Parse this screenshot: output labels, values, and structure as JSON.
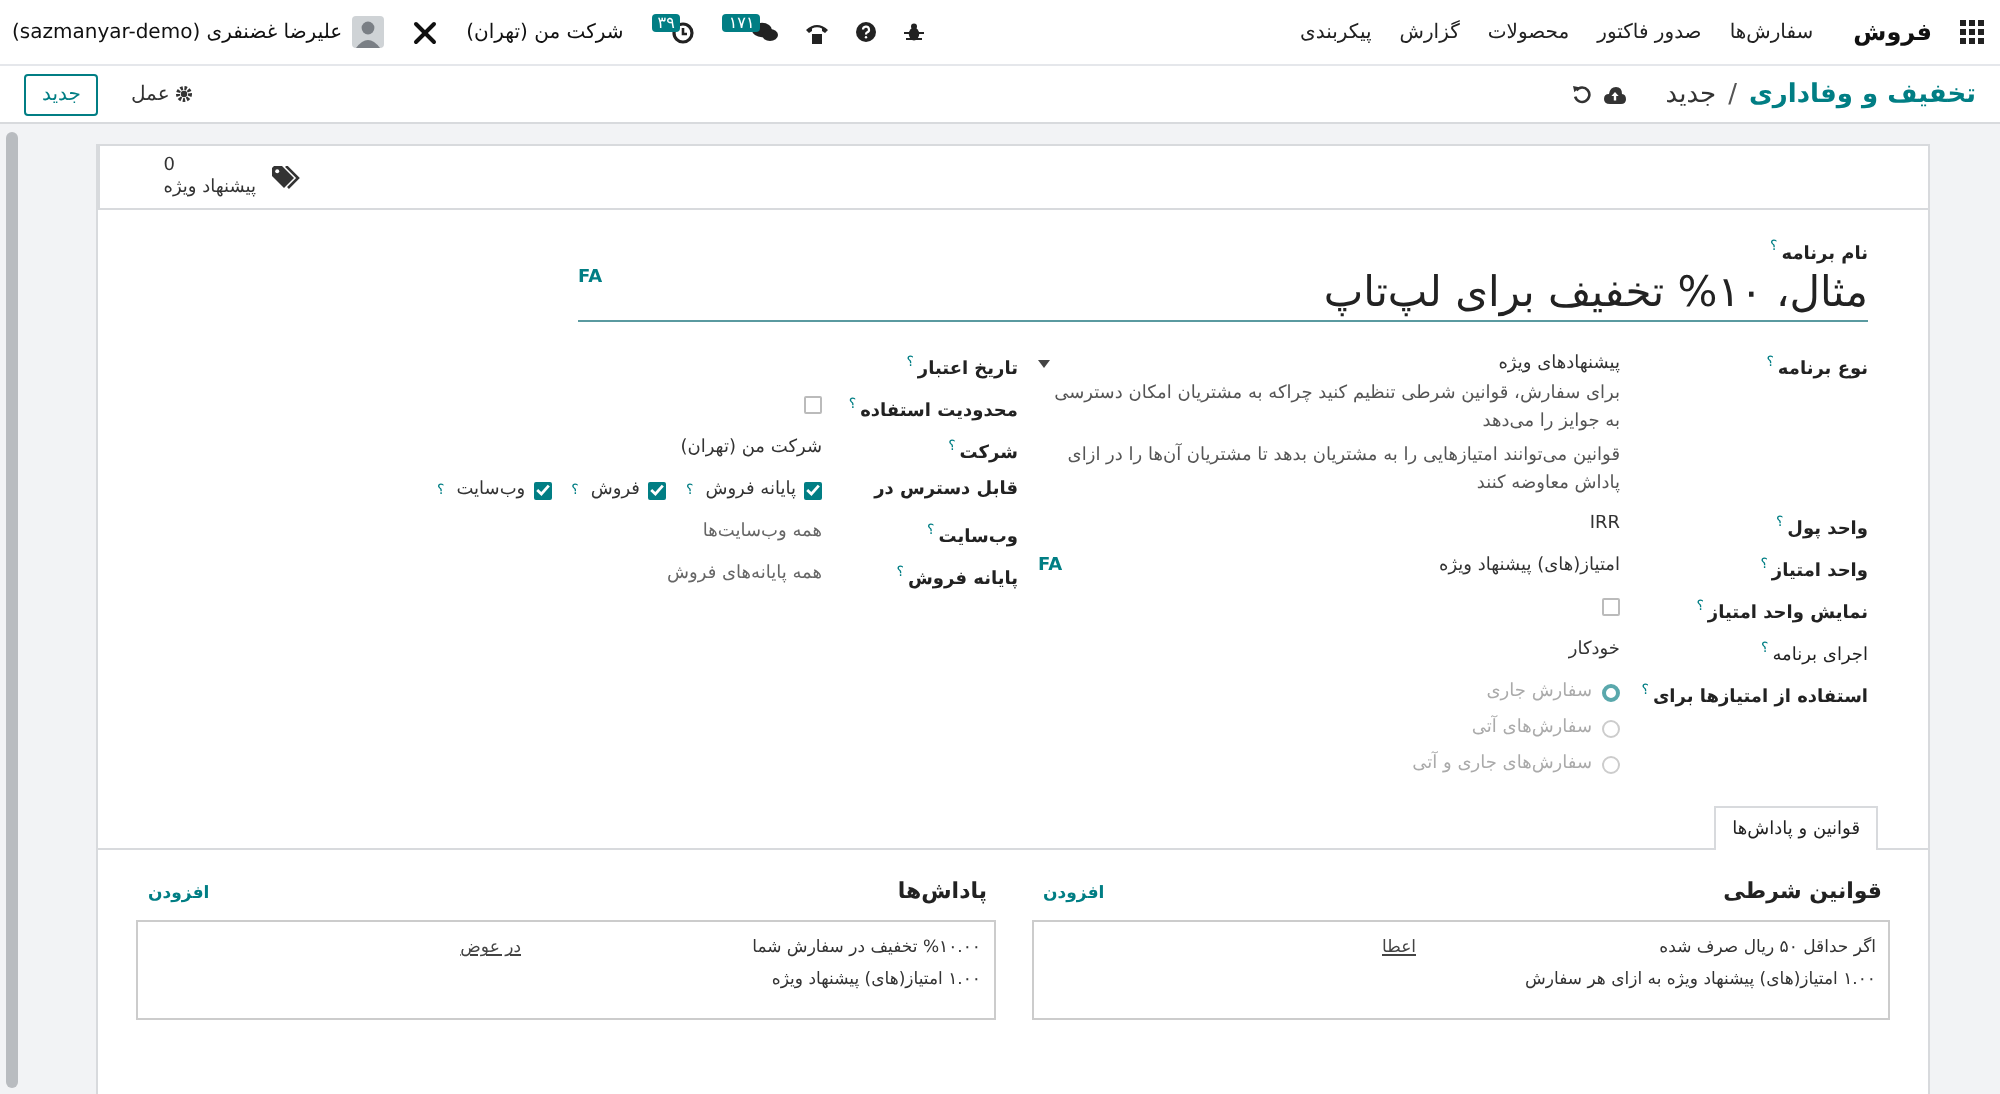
{
  "navbar": {
    "app_name": "فروش",
    "menu": [
      "سفارش‌ها",
      "صدور فاکتور",
      "محصولات",
      "گزارش",
      "پیکربندی"
    ],
    "message_count": "۱۷۱",
    "activity_count": "۳۹",
    "company": "شرکت من (تهران)",
    "user": "علیرضا غضنفری (sazmanyar-demo)"
  },
  "breadcrumb": {
    "parent": "تخفیف و وفاداری",
    "separator": "/",
    "current": "جدید"
  },
  "toolbar": {
    "action_menu": "عمل",
    "new_button": "جدید"
  },
  "stat_button": {
    "value": "0",
    "label": "پیشنهاد ویژه"
  },
  "form": {
    "name_label": "نام برنامه",
    "name_help": "؟",
    "name": "مثال، ۱۰% تخفیف برای لپ‌تاپ",
    "name_lang": "FA",
    "right_fields": [
      {
        "kind": "select",
        "label": "نوع برنامه",
        "help": "؟",
        "bold": true,
        "value": "پیشنهادهای ویژه",
        "description": [
          "برای سفارش، قوانین شرطی تنظیم کنید چراکه به مشتریان امکان دسترسی به جوایز را می‌دهد",
          "قوانین می‌توانند امتیازهایی را به مشتریان بدهد تا مشتریان آن‌ها را در ازای پاداش معاوضه کنند"
        ]
      },
      {
        "kind": "text",
        "label": "واحد پول",
        "help": "؟",
        "bold": true,
        "value": "IRR"
      },
      {
        "kind": "text",
        "label": "واحد امتیاز",
        "help": "؟",
        "bold": true,
        "value": "امتیاز(های) پیشنهاد ویژه",
        "lang": "FA"
      },
      {
        "kind": "checkbox",
        "label": "نمایش واحد امتیاز",
        "help": "؟",
        "bold": true,
        "checked": false
      },
      {
        "kind": "text",
        "label": "اجرای برنامه",
        "help": "؟",
        "bold": false,
        "value": "خودکار"
      },
      {
        "kind": "radio",
        "label": "استفاده از امتیازها برای",
        "help": "؟",
        "bold": true,
        "disabled": true,
        "options": [
          {
            "label": "سفارش جاری",
            "selected": true
          },
          {
            "label": "سفارش‌های آتی",
            "selected": false
          },
          {
            "label": "سفارش‌های جاری و آتی",
            "selected": false
          }
        ]
      }
    ],
    "left_fields": [
      {
        "kind": "empty",
        "label": "تاریخ اعتبار",
        "help": "؟",
        "bold": true
      },
      {
        "kind": "checkbox",
        "label": "محدودیت استفاده",
        "help": "؟",
        "bold": true,
        "checked": false
      },
      {
        "kind": "text",
        "label": "شرکت",
        "help": "؟",
        "bold": true,
        "value": "شرکت من (تهران)"
      },
      {
        "kind": "checks",
        "label": "قابل دسترس در",
        "bold": true,
        "options": [
          {
            "label": "پایانه فروش",
            "help": "؟",
            "checked": true
          },
          {
            "label": "فروش",
            "help": "؟",
            "checked": true
          },
          {
            "label": "وب‌سایت",
            "help": "؟",
            "checked": true
          }
        ]
      },
      {
        "kind": "placeholder",
        "label": "وب‌سایت",
        "help": "؟",
        "bold": true,
        "placeholder": "همه وب‌سایت‌ها"
      },
      {
        "kind": "placeholder",
        "label": "پایانه فروش",
        "help": "؟",
        "bold": true,
        "placeholder": "همه پایانه‌های فروش"
      }
    ]
  },
  "notebook": {
    "tabs": [
      {
        "label": "قوانین و پاداش‌ها",
        "selected": true
      }
    ],
    "sections": [
      {
        "title": "قوانین شرطی",
        "add_link": "افزودن",
        "cards": [
          {
            "line1": "اگر حداقل ۵۰ ریال صرف شده",
            "tag": "اعطا",
            "line2": "۱.۰۰ امتیاز(های) پیشنهاد ویژه به ازای هر سفارش"
          }
        ]
      },
      {
        "title": "پاداش‌ها",
        "add_link": "افزودن",
        "cards": [
          {
            "line1": "%۱۰.۰۰ تخفیف در سفارش شما",
            "tag": "در عوض",
            "line2": "۱.۰۰ امتیاز(های) پیشنهاد ویژه"
          }
        ]
      }
    ]
  }
}
